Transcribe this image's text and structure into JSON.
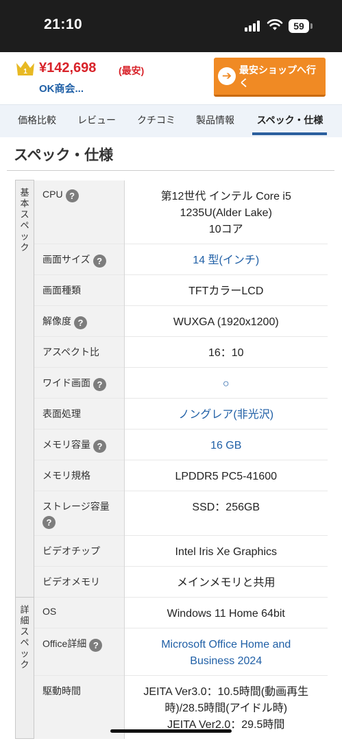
{
  "status_bar": {
    "time": "21:10",
    "battery": "59"
  },
  "header": {
    "rank": "1",
    "price": "¥142,698",
    "price_note": "(最安)",
    "shop": "OK商会...",
    "cheapest_button": "最安ショップへ行く",
    "cheapest_icon": "arrow-right-icon"
  },
  "tabs": [
    {
      "label": "価格比較"
    },
    {
      "label": "レビュー"
    },
    {
      "label": "クチコミ"
    },
    {
      "label": "製品情報"
    },
    {
      "label": "スペック・仕様",
      "active": true
    }
  ],
  "section_title": "スペック・仕様",
  "spec_groups": [
    {
      "name": "基本スペック",
      "rows": [
        {
          "label": "CPU",
          "help": true,
          "value": "第12世代 インテル Core i5\n1235U(Alder Lake)\n10コア",
          "link": false
        },
        {
          "label": "画面サイズ",
          "help": true,
          "value": "14 型(インチ)",
          "link": true
        },
        {
          "label": "画面種類",
          "help": false,
          "value": "TFTカラーLCD",
          "link": false
        },
        {
          "label": "解像度",
          "help": true,
          "value": "WUXGA (1920x1200)",
          "link": false
        },
        {
          "label": "アスペクト比",
          "help": false,
          "value": "16：10",
          "link": false
        },
        {
          "label": "ワイド画面",
          "help": true,
          "value": "○",
          "link": true
        },
        {
          "label": "表面処理",
          "help": false,
          "value": "ノングレア(非光沢)",
          "link": true
        },
        {
          "label": "メモリ容量",
          "help": true,
          "value": "16 GB",
          "link": true
        },
        {
          "label": "メモリ規格",
          "help": false,
          "value": "LPDDR5 PC5-41600",
          "link": false
        },
        {
          "label": "ストレージ容量",
          "help": true,
          "help_below": true,
          "value": "SSD：256GB",
          "link": false
        },
        {
          "label": "ビデオチップ",
          "help": false,
          "value": "Intel Iris Xe Graphics",
          "link": false
        },
        {
          "label": "ビデオメモリ",
          "help": false,
          "value": "メインメモリと共用",
          "link": false
        }
      ]
    },
    {
      "name": "詳細スペック",
      "rows": [
        {
          "label": "OS",
          "help": false,
          "value": "Windows 11 Home 64bit",
          "link": false
        },
        {
          "label": "Office詳細",
          "help": true,
          "value": "Microsoft Office Home and\nBusiness 2024",
          "link": true
        },
        {
          "label": "駆動時間",
          "help": false,
          "value": "JEITA Ver3.0：10.5時間(動画再生\n時)/28.5時間(アイドル時)\nJEITA Ver2.0：29.5時間",
          "link": false
        }
      ]
    }
  ],
  "colors": {
    "price": "#d8232a",
    "link": "#1f5fa6",
    "button": "#f08a24",
    "tab_active": "#2b5f9e"
  }
}
